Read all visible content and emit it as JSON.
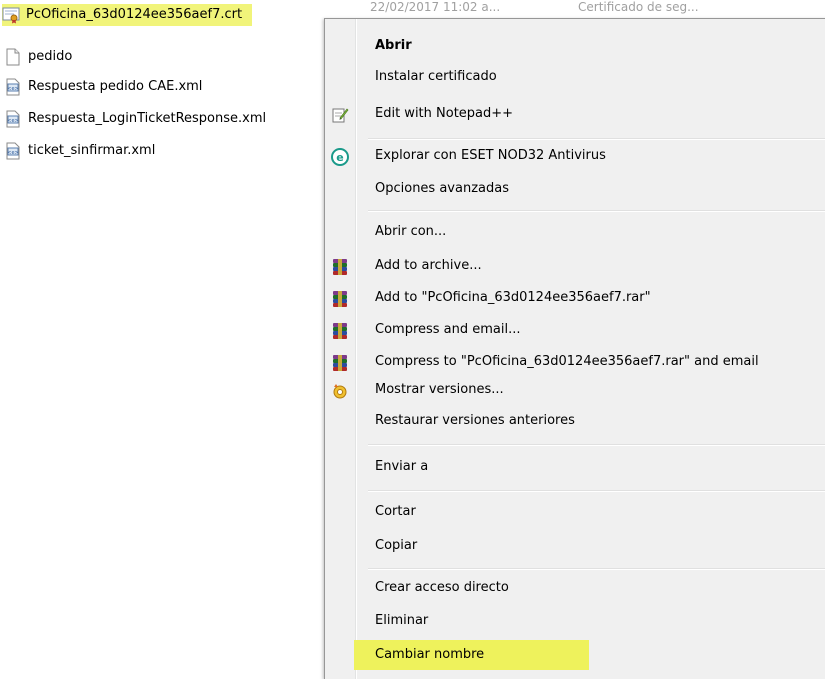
{
  "files": [
    {
      "name": "PcOficina_63d0124ee356aef7.crt",
      "icon": "certificate-file-icon",
      "selected": true
    },
    {
      "name": "pedido",
      "icon": "blank-file-icon"
    },
    {
      "name": "Respuesta pedido CAE.xml",
      "icon": "xml-file-icon"
    },
    {
      "name": "Respuesta_LoginTicketResponse.xml",
      "icon": "xml-file-icon"
    },
    {
      "name": "ticket_sinfirmar.xml",
      "icon": "xml-file-icon"
    }
  ],
  "selected_file_meta": {
    "date": "22/02/2017 11:02 a...",
    "type": "Certificado de seg..."
  },
  "context_menu": {
    "items": [
      {
        "label": "Abrir",
        "bold": true
      },
      {
        "label": "Instalar certificado"
      },
      {
        "label": "Edit with Notepad++",
        "icon": "notepad-plus-plus-icon"
      },
      {
        "label": "Explorar con ESET NOD32 Antivirus",
        "icon": "eset-icon"
      },
      {
        "label": "Opciones avanzadas"
      },
      {
        "label": "Abrir con..."
      },
      {
        "label": "Add to archive...",
        "icon": "winrar-icon"
      },
      {
        "label": "Add to \"PcOficina_63d0124ee356aef7.rar\"",
        "icon": "winrar-icon"
      },
      {
        "label": "Compress and email...",
        "icon": "winrar-icon"
      },
      {
        "label": "Compress to \"PcOficina_63d0124ee356aef7.rar\" and email",
        "icon": "winrar-icon"
      },
      {
        "label": "Mostrar versiones...",
        "icon": "versions-icon"
      },
      {
        "label": "Restaurar versiones anteriores"
      },
      {
        "label": "Enviar a"
      },
      {
        "label": "Cortar"
      },
      {
        "label": "Copiar"
      },
      {
        "label": "Crear acceso directo"
      },
      {
        "label": "Eliminar"
      },
      {
        "label": "Cambiar nombre",
        "highlighted": true
      }
    ]
  },
  "colors": {
    "selection_highlight": "#f1f47a",
    "menu_background": "#f0f0f0"
  }
}
